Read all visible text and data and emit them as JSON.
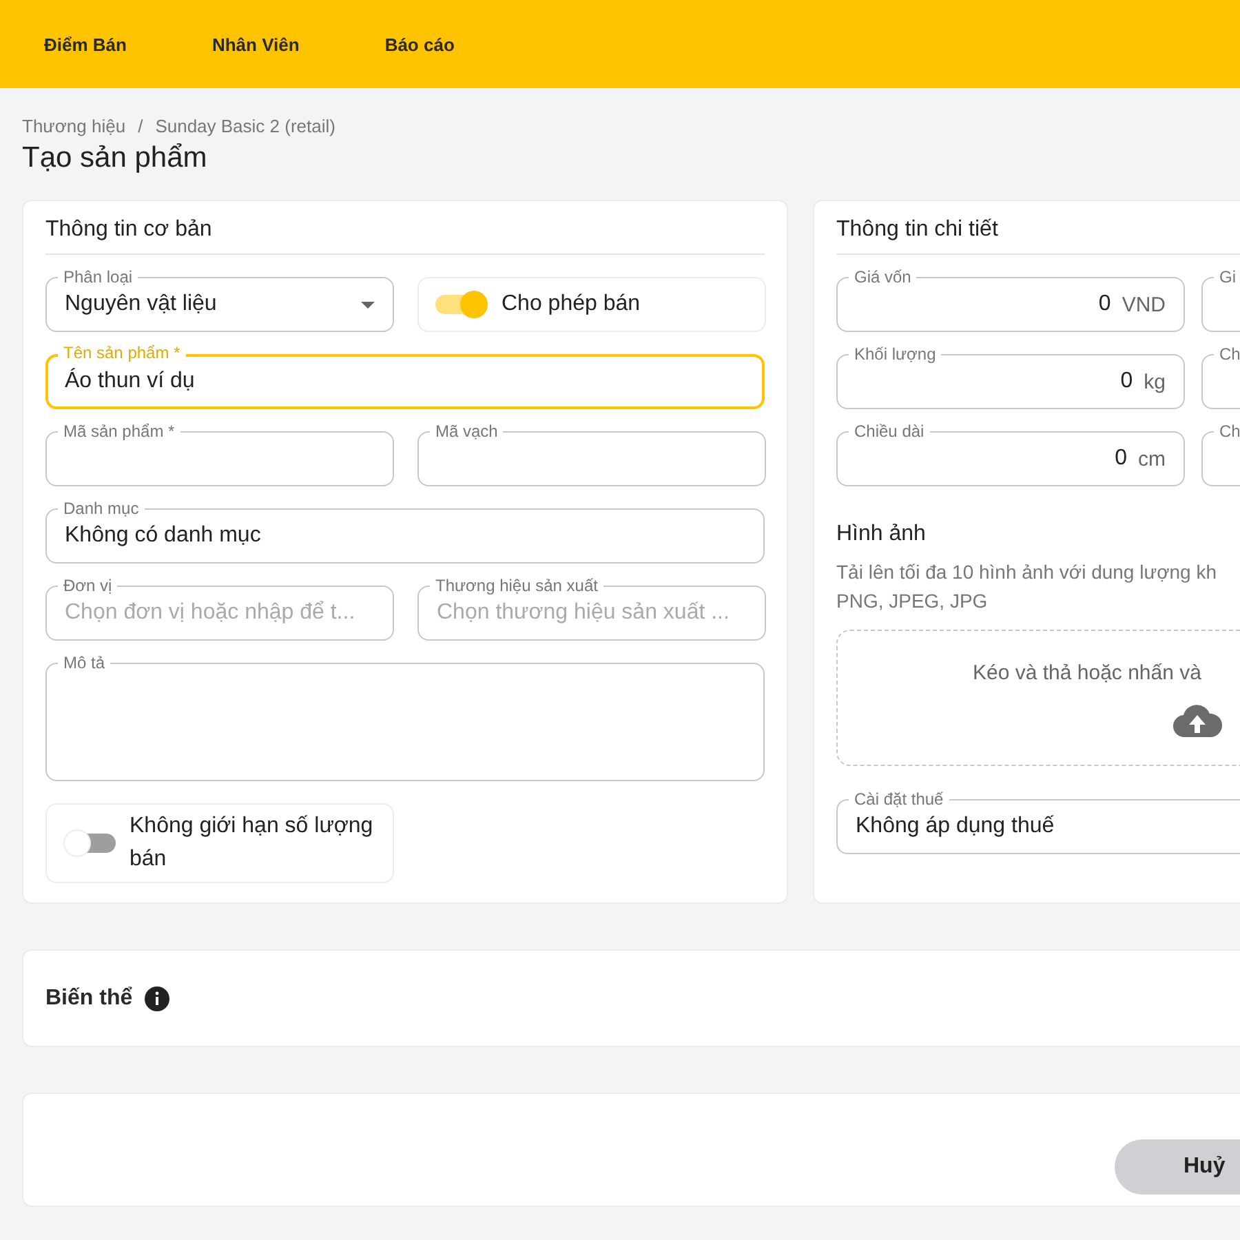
{
  "nav": [
    {
      "label": "Điểm Bán"
    },
    {
      "label": "Nhân Viên"
    },
    {
      "label": "Báo cáo"
    }
  ],
  "breadcrumb": {
    "items": [
      "Thương hiệu",
      "Sunday Basic 2 (retail)"
    ],
    "separator": "/"
  },
  "title": "Tạo sản phẩm",
  "basic_info": {
    "title": "Thông tin cơ bản",
    "rows": [
      [
        {
          "kind": "select",
          "label": "Phân loại",
          "value": "Nguyên vật liệu"
        },
        {
          "kind": "toggle",
          "label": "Cho phép bán",
          "on": true
        }
      ],
      [
        {
          "kind": "text",
          "label": "Tên sản phẩm *",
          "value": "Áo thun ví dụ",
          "focused": true
        }
      ],
      [
        {
          "kind": "text",
          "label": "Mã sản phẩm *"
        },
        {
          "kind": "text",
          "label": "Mã vạch"
        }
      ],
      [
        {
          "kind": "text",
          "label": "Danh mục",
          "value": "Không có danh mục"
        }
      ],
      [
        {
          "kind": "text",
          "label": "Đơn vị",
          "placeholder": "Chọn đơn vị hoặc nhập để t..."
        },
        {
          "kind": "text",
          "label": "Thương hiệu sản xuất",
          "placeholder": "Chọn thương hiệu sản xuất ..."
        }
      ],
      [
        {
          "kind": "textarea",
          "label": "Mô tả"
        }
      ],
      [
        {
          "kind": "toggle",
          "label": "Không giới hạn số lượng bán",
          "on": false
        },
        {
          "kind": "empty"
        }
      ]
    ]
  },
  "details": {
    "title": "Thông tin chi tiết",
    "rows": [
      [
        {
          "kind": "number",
          "label": "Giá vốn",
          "value": "0",
          "unit": "VND"
        },
        {
          "kind": "number",
          "label": "Gi"
        }
      ],
      [
        {
          "kind": "number",
          "label": "Khối lượng",
          "value": "0",
          "unit": "kg"
        },
        {
          "kind": "number",
          "label": "Ch"
        }
      ],
      [
        {
          "kind": "number",
          "label": "Chiều dài",
          "value": "0",
          "unit": "cm"
        },
        {
          "kind": "number",
          "label": "Ch"
        }
      ]
    ],
    "images": {
      "title": "Hình ảnh",
      "hint_lines": [
        "Tải lên tối đa 10 hình ảnh với dung lượng kh",
        "PNG, JPEG, JPG"
      ],
      "dropzone": "Kéo và thả hoặc nhấn và"
    },
    "tax": {
      "label": "Cài đặt thuế",
      "value": "Không áp dụng thuế"
    }
  },
  "variants": {
    "title": "Biến thể"
  },
  "footer": {
    "buttons": [
      "Huỷ"
    ]
  }
}
